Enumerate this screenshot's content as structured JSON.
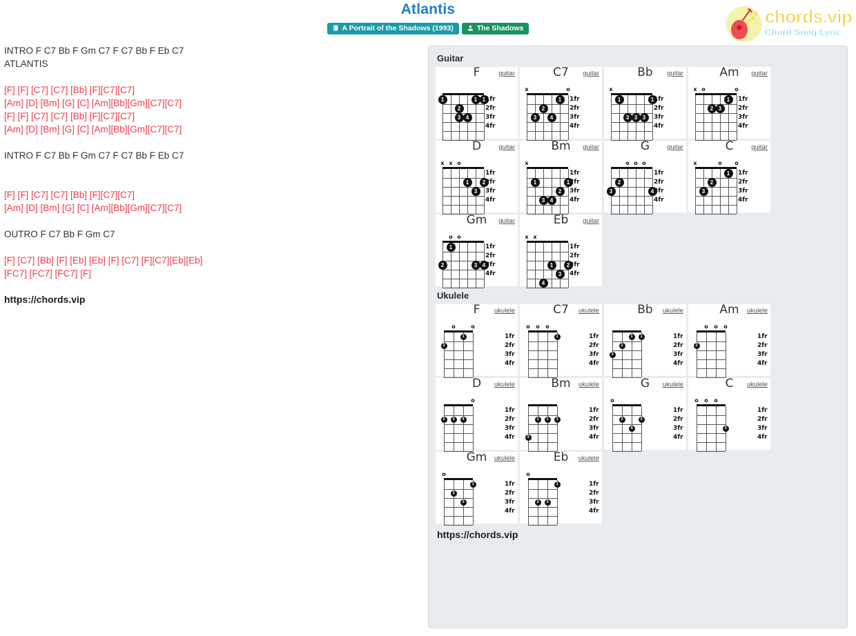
{
  "header": {
    "title": "Atlantis",
    "album_badge": {
      "icon": "book-icon",
      "label": "A Portrait of the Shadows (1993)",
      "color": "#1a9ba8"
    },
    "artist_badge": {
      "icon": "user-icon",
      "label": "The Shadows",
      "color": "#18935f"
    }
  },
  "logo": {
    "main": "chords.vip",
    "sub": "Chord Song Lyric",
    "icon": "guitar-icon",
    "main_color": "#f6cf3f",
    "sub_color": "#4ec9e8"
  },
  "lyrics": {
    "chord_color": "#ef3b46",
    "text_color": "#333333",
    "lines": [
      {
        "type": "plain",
        "text": "INTRO F C7 Bb F Gm C7 F C7 Bb F Eb C7"
      },
      {
        "type": "plain",
        "text": "ATLANTIS"
      },
      {
        "type": "blank",
        "text": ""
      },
      {
        "type": "chord",
        "text": "[F] [F] [C7] [C7] [Bb] [F][C7][C7]"
      },
      {
        "type": "chord",
        "text": "[Am] [D] [Bm] [G] [C] [Am][Bb][Gm][C7][C7]"
      },
      {
        "type": "chord",
        "text": "[F] [F] [C7] [C7] [Bb] [F][C7][C7]"
      },
      {
        "type": "chord",
        "text": "[Am] [D] [Bm] [G] [C] [Am][Bb][Gm][C7][C7]"
      },
      {
        "type": "blank",
        "text": ""
      },
      {
        "type": "plain",
        "text": "INTRO F C7 Bb F Gm C7 F C7 Bb F Eb C7"
      },
      {
        "type": "blank",
        "text": ""
      },
      {
        "type": "blank",
        "text": ""
      },
      {
        "type": "chord",
        "text": "[F] [F] [C7] [C7] [Bb] [F][C7][C7]"
      },
      {
        "type": "chord",
        "text": "[Am] [D] [Bm] [G] [C] [Am][Bb][Gm][C7][C7]"
      },
      {
        "type": "blank",
        "text": ""
      },
      {
        "type": "plain",
        "text": "OUTRO F C7 Bb F Gm C7"
      },
      {
        "type": "blank",
        "text": ""
      },
      {
        "type": "chord",
        "text": "[F] [C7] [Bb] [F] [Eb] [Eb] [F] [C7] [F][C7][Eb][Eb]"
      },
      {
        "type": "chord",
        "text": "[FC7] [FC7] [FC7] [F]"
      },
      {
        "type": "blank",
        "text": ""
      },
      {
        "type": "link",
        "text": "https://chords.vip"
      }
    ]
  },
  "panel": {
    "guitar_section": "Guitar",
    "ukulele_section": "Ukulele",
    "footer": "https://chords.vip",
    "fret_labels": [
      "1fr",
      "2fr",
      "3fr",
      "4fr"
    ],
    "guitar_label": "guitar",
    "ukulele_label": "ukulele",
    "guitar_chords": [
      {
        "name": "F",
        "type": "guitar",
        "strings": 6,
        "open": [
          "",
          "",
          "",
          "",
          "",
          ""
        ],
        "dots": [
          {
            "s": 6,
            "f": 1,
            "n": "1"
          },
          {
            "s": 2,
            "f": 1,
            "n": "1"
          },
          {
            "s": 1,
            "f": 1,
            "n": "1"
          },
          {
            "s": 4,
            "f": 2,
            "n": "2"
          },
          {
            "s": 3,
            "f": 3,
            "n": "4"
          },
          {
            "s": 4,
            "f": 3,
            "n": "3"
          }
        ]
      },
      {
        "name": "C7",
        "type": "guitar",
        "strings": 6,
        "open": [
          "x",
          "",
          "",
          "",
          "",
          "o"
        ],
        "dots": [
          {
            "s": 2,
            "f": 1,
            "n": "1"
          },
          {
            "s": 4,
            "f": 2,
            "n": "2"
          },
          {
            "s": 5,
            "f": 3,
            "n": "3"
          },
          {
            "s": 3,
            "f": 3,
            "n": "4"
          }
        ]
      },
      {
        "name": "Bb",
        "type": "guitar",
        "strings": 6,
        "open": [
          "x",
          "",
          "",
          "",
          "",
          ""
        ],
        "dots": [
          {
            "s": 5,
            "f": 1,
            "n": "1"
          },
          {
            "s": 1,
            "f": 1,
            "n": "1"
          },
          {
            "s": 4,
            "f": 3,
            "n": "3"
          },
          {
            "s": 3,
            "f": 3,
            "n": "3"
          },
          {
            "s": 2,
            "f": 3,
            "n": "3"
          }
        ]
      },
      {
        "name": "Am",
        "type": "guitar",
        "strings": 6,
        "open": [
          "x",
          "o",
          "",
          "",
          "",
          "o"
        ],
        "dots": [
          {
            "s": 2,
            "f": 1,
            "n": "1"
          },
          {
            "s": 4,
            "f": 2,
            "n": "2"
          },
          {
            "s": 3,
            "f": 2,
            "n": "3"
          }
        ]
      },
      {
        "name": "D",
        "type": "guitar",
        "strings": 6,
        "open": [
          "x",
          "x",
          "o",
          "",
          "",
          ""
        ],
        "dots": [
          {
            "s": 3,
            "f": 2,
            "n": "1"
          },
          {
            "s": 1,
            "f": 2,
            "n": "2"
          },
          {
            "s": 2,
            "f": 3,
            "n": "3"
          }
        ]
      },
      {
        "name": "Bm",
        "type": "guitar",
        "strings": 6,
        "open": [
          "x",
          "",
          "",
          "",
          "",
          ""
        ],
        "dots": [
          {
            "s": 5,
            "f": 2,
            "n": "1"
          },
          {
            "s": 1,
            "f": 2,
            "n": "1"
          },
          {
            "s": 2,
            "f": 3,
            "n": "2"
          },
          {
            "s": 4,
            "f": 4,
            "n": "3"
          },
          {
            "s": 3,
            "f": 4,
            "n": "4"
          }
        ]
      },
      {
        "name": "G",
        "type": "guitar",
        "strings": 6,
        "open": [
          "",
          "",
          "o",
          "o",
          "o",
          ""
        ],
        "dots": [
          {
            "s": 5,
            "f": 2,
            "n": "2"
          },
          {
            "s": 6,
            "f": 3,
            "n": "3"
          },
          {
            "s": 1,
            "f": 3,
            "n": "4"
          }
        ]
      },
      {
        "name": "C",
        "type": "guitar",
        "strings": 6,
        "open": [
          "x",
          "",
          "",
          "o",
          "",
          "o"
        ],
        "dots": [
          {
            "s": 2,
            "f": 1,
            "n": "1"
          },
          {
            "s": 4,
            "f": 2,
            "n": "2"
          },
          {
            "s": 5,
            "f": 3,
            "n": "3"
          }
        ]
      },
      {
        "name": "Gm",
        "type": "guitar",
        "strings": 6,
        "open": [
          "",
          "o",
          "o",
          "",
          "",
          ""
        ],
        "dots": [
          {
            "s": 5,
            "f": 1,
            "n": "1"
          },
          {
            "s": 6,
            "f": 3,
            "n": "2"
          },
          {
            "s": 2,
            "f": 3,
            "n": "3"
          },
          {
            "s": 1,
            "f": 3,
            "n": "4"
          }
        ]
      },
      {
        "name": "Eb",
        "type": "guitar",
        "strings": 6,
        "open": [
          "x",
          "x",
          "",
          "",
          "",
          ""
        ],
        "dots": [
          {
            "s": 3,
            "f": 3,
            "n": "1"
          },
          {
            "s": 1,
            "f": 3,
            "n": "2"
          },
          {
            "s": 2,
            "f": 4,
            "n": "3"
          },
          {
            "s": 4,
            "f": 5,
            "n": "4"
          }
        ]
      }
    ],
    "ukulele_chords": [
      {
        "name": "F",
        "type": "ukulele",
        "strings": 4,
        "open": [
          "",
          "o",
          "",
          "o"
        ],
        "dots": [
          {
            "s": 2,
            "f": 1,
            "n": "1"
          },
          {
            "s": 4,
            "f": 2,
            "n": "2"
          }
        ]
      },
      {
        "name": "C7",
        "type": "ukulele",
        "strings": 4,
        "open": [
          "o",
          "o",
          "o",
          ""
        ],
        "dots": [
          {
            "s": 1,
            "f": 1,
            "n": "1"
          }
        ]
      },
      {
        "name": "Bb",
        "type": "ukulele",
        "strings": 4,
        "open": [
          "",
          "",
          "",
          ""
        ],
        "dots": [
          {
            "s": 2,
            "f": 1,
            "n": "1"
          },
          {
            "s": 1,
            "f": 1,
            "n": "1"
          },
          {
            "s": 3,
            "f": 2,
            "n": "2"
          },
          {
            "s": 4,
            "f": 3,
            "n": "3"
          }
        ]
      },
      {
        "name": "Am",
        "type": "ukulele",
        "strings": 4,
        "open": [
          "",
          "o",
          "o",
          "o"
        ],
        "dots": [
          {
            "s": 4,
            "f": 2,
            "n": "2"
          }
        ]
      },
      {
        "name": "D",
        "type": "ukulele",
        "strings": 4,
        "open": [
          "",
          "",
          "",
          "o"
        ],
        "dots": [
          {
            "s": 4,
            "f": 2,
            "n": "2"
          },
          {
            "s": 3,
            "f": 2,
            "n": "3"
          },
          {
            "s": 2,
            "f": 2,
            "n": "4"
          }
        ]
      },
      {
        "name": "Bm",
        "type": "ukulele",
        "strings": 4,
        "open": [
          "",
          "",
          "",
          ""
        ],
        "dots": [
          {
            "s": 3,
            "f": 2,
            "n": "1"
          },
          {
            "s": 2,
            "f": 2,
            "n": "1"
          },
          {
            "s": 1,
            "f": 2,
            "n": "1"
          },
          {
            "s": 4,
            "f": 4,
            "n": "3"
          }
        ]
      },
      {
        "name": "G",
        "type": "ukulele",
        "strings": 4,
        "open": [
          "o",
          "",
          "",
          ""
        ],
        "dots": [
          {
            "s": 3,
            "f": 2,
            "n": "2"
          },
          {
            "s": 1,
            "f": 2,
            "n": "3"
          },
          {
            "s": 2,
            "f": 3,
            "n": "4"
          }
        ]
      },
      {
        "name": "C",
        "type": "ukulele",
        "strings": 4,
        "open": [
          "o",
          "o",
          "o",
          ""
        ],
        "dots": [
          {
            "s": 1,
            "f": 3,
            "n": "3"
          }
        ]
      },
      {
        "name": "Gm",
        "type": "ukulele",
        "strings": 4,
        "open": [
          "o",
          "",
          "",
          ""
        ],
        "dots": [
          {
            "s": 1,
            "f": 1,
            "n": "1"
          },
          {
            "s": 3,
            "f": 2,
            "n": "2"
          },
          {
            "s": 2,
            "f": 3,
            "n": "3"
          }
        ]
      },
      {
        "name": "Eb",
        "type": "ukulele",
        "strings": 4,
        "open": [
          "o",
          "",
          "",
          ""
        ],
        "dots": [
          {
            "s": 1,
            "f": 1,
            "n": "1"
          },
          {
            "s": 3,
            "f": 3,
            "n": "2"
          },
          {
            "s": 2,
            "f": 3,
            "n": "3"
          }
        ]
      }
    ]
  }
}
